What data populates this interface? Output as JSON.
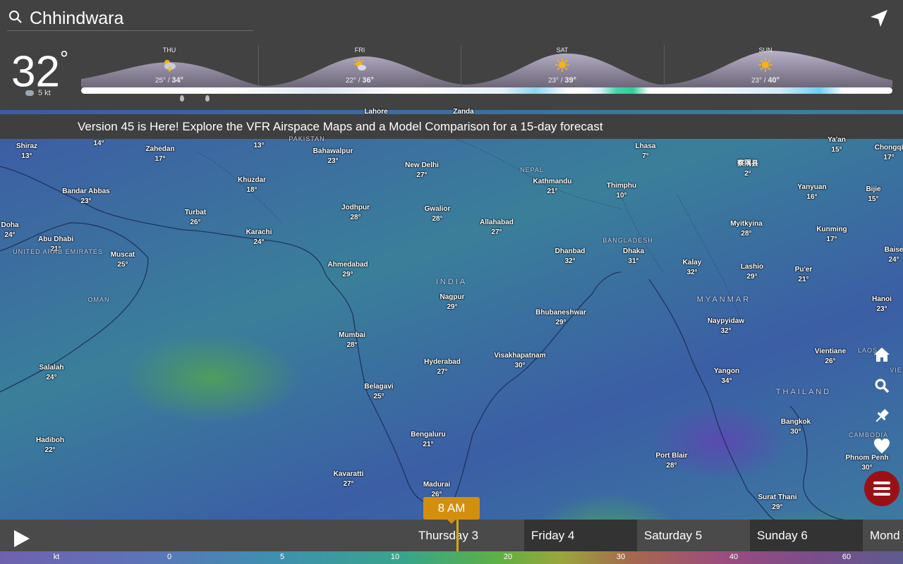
{
  "search": {
    "value": "Chhindwara"
  },
  "current": {
    "temp": "32",
    "unit": "°",
    "wind": "5 kt"
  },
  "forecast": [
    {
      "day": "THU",
      "low": "25°",
      "high": "34°",
      "icon": "thunderstorm-icon"
    },
    {
      "day": "FRI",
      "low": "22°",
      "high": "36°",
      "icon": "partly-sunny-icon"
    },
    {
      "day": "SAT",
      "low": "23°",
      "high": "39°",
      "icon": "sunny-icon"
    },
    {
      "day": "SUN",
      "low": "23°",
      "high": "40°",
      "icon": "sunny-icon"
    }
  ],
  "banner": "Version 45 is Here! Explore the VFR Airspace Maps and a Model Comparison for a 15-day forecast",
  "cities": [
    {
      "name": "Shiraz",
      "temp": "13°"
    },
    {
      "name": "Zahedan",
      "temp": "17°"
    },
    {
      "name": "Bahawalpur",
      "temp": "23°"
    },
    {
      "name": "New Delhi",
      "temp": "27°"
    },
    {
      "name": "Lhasa",
      "temp": "7°"
    },
    {
      "name": "察隅县",
      "temp": "2°"
    },
    {
      "name": "Ya'an",
      "temp": "15°"
    },
    {
      "name": "Chongqi",
      "temp": "17°"
    },
    {
      "name": "Bandar Abbas",
      "temp": "23°"
    },
    {
      "name": "Khuzdar",
      "temp": "18°"
    },
    {
      "name": "Kathmandu",
      "temp": "21°"
    },
    {
      "name": "Thimphu",
      "temp": "10°"
    },
    {
      "name": "Yanyuan",
      "temp": "16°"
    },
    {
      "name": "Bijie",
      "temp": "15°"
    },
    {
      "name": "Turbat",
      "temp": "26°"
    },
    {
      "name": "Jodhpur",
      "temp": "28°"
    },
    {
      "name": "Gwalior",
      "temp": "28°"
    },
    {
      "name": "Doha",
      "temp": "24°"
    },
    {
      "name": "Abu Dhabi",
      "temp": "21°"
    },
    {
      "name": "Karachi",
      "temp": "24°"
    },
    {
      "name": "Allahabad",
      "temp": "27°"
    },
    {
      "name": "Myitkyina",
      "temp": "28°"
    },
    {
      "name": "Kunming",
      "temp": "17°"
    },
    {
      "name": "Dhanbad",
      "temp": "32°"
    },
    {
      "name": "Dhaka",
      "temp": "31°"
    },
    {
      "name": "Muscat",
      "temp": "25°"
    },
    {
      "name": "Ahmedabad",
      "temp": "29°"
    },
    {
      "name": "Kalay",
      "temp": "32°"
    },
    {
      "name": "Lashio",
      "temp": "29°"
    },
    {
      "name": "Pu'er",
      "temp": "21°"
    },
    {
      "name": "Baise",
      "temp": "24°"
    },
    {
      "name": "Nagpur",
      "temp": "29°"
    },
    {
      "name": "Bhubaneshwar",
      "temp": "29°"
    },
    {
      "name": "Hanoi",
      "temp": "23°"
    },
    {
      "name": "Naypyidaw",
      "temp": "32°"
    },
    {
      "name": "Mumbai",
      "temp": "28°"
    },
    {
      "name": "Vientiane",
      "temp": "26°"
    },
    {
      "name": "Visakhapatnam",
      "temp": "30°"
    },
    {
      "name": "Hyderabad",
      "temp": "27°"
    },
    {
      "name": "Salalah",
      "temp": "24°"
    },
    {
      "name": "Yangon",
      "temp": "34°"
    },
    {
      "name": "Belagavi",
      "temp": "25°"
    },
    {
      "name": "Bangkok",
      "temp": "30°"
    },
    {
      "name": "Bengaluru",
      "temp": "21°"
    },
    {
      "name": "Hadiboh",
      "temp": "22°"
    },
    {
      "name": "Port Blair",
      "temp": "28°"
    },
    {
      "name": "Phnom Penh",
      "temp": "30°"
    },
    {
      "name": "Kavaratti",
      "temp": "27°"
    },
    {
      "name": "Madurai",
      "temp": "26°"
    },
    {
      "name": "Surat Thani",
      "temp": "29°"
    },
    {
      "name": "Lahore",
      "temp": ""
    },
    {
      "name": "Zanda",
      "temp": ""
    },
    {
      "name": "",
      "temp": "14°"
    },
    {
      "name": "",
      "temp": "13°"
    }
  ],
  "countries": [
    "PAKISTAN",
    "NEPAL",
    "UNITED ARAB EMIRATES",
    "BANGLADESH",
    "INDIA",
    "OMAN",
    "MYANMAR",
    "THAILAND",
    "LAOS",
    "CAMBODIA",
    "VIE"
  ],
  "timeline": {
    "time": "8 AM",
    "days": [
      "Thursday 3",
      "Friday 4",
      "Saturday 5",
      "Sunday 6",
      "Mond"
    ],
    "selected_day": "Thursday 3"
  },
  "legend": {
    "unit": "kt",
    "ticks": [
      "0",
      "5",
      "10",
      "20",
      "30",
      "40",
      "60"
    ]
  },
  "colors": {
    "menu_button": "#9a1115",
    "time_pill": "#d28f0f",
    "topbar": "#424242"
  }
}
